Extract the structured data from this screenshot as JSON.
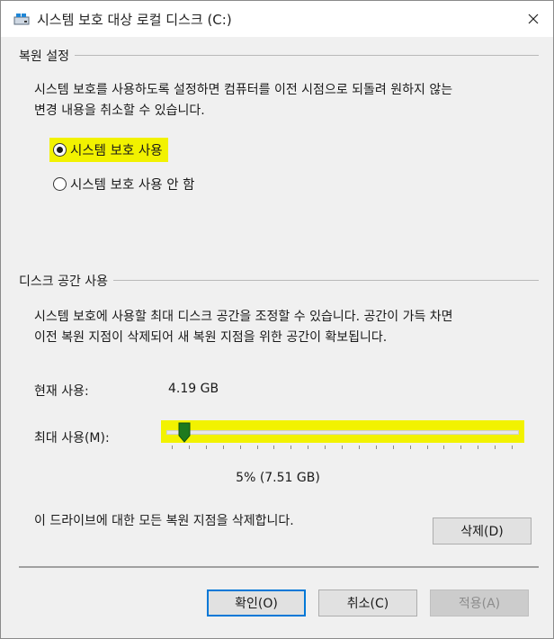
{
  "window": {
    "title": "시스템 보호 대상 로컬 디스크 (C:)",
    "close_glyph": "✕"
  },
  "restore_settings": {
    "heading": "복원 설정",
    "description_line1": "시스템 보호를 사용하도록 설정하면 컴퓨터를 이전 시점으로 되돌려 원하지 않는",
    "description_line2": "변경 내용을 취소할 수 있습니다.",
    "options": [
      {
        "label": "시스템 보호 사용",
        "selected": true
      },
      {
        "label": "시스템 보호 사용 안 함",
        "selected": false
      }
    ]
  },
  "disk_usage": {
    "heading": "디스크 공간 사용",
    "description_line1": "시스템 보호에 사용할 최대 디스크 공간을 조정할 수 있습니다. 공간이 가득 차면",
    "description_line2": "이전 복원 지점이 삭제되어 새 복원 지점을 위한 공간이 확보됩니다.",
    "current_label": "현재 사용:",
    "current_value": "4.19 GB",
    "max_label": "최대 사용(M):",
    "slider_percent": 5,
    "max_display": "5% (7.51 GB)",
    "delete_text": "이 드라이브에 대한 모든 복원 지점을 삭제합니다.",
    "delete_button": "삭제(D)"
  },
  "footer": {
    "ok": "확인(O)",
    "cancel": "취소(C)",
    "apply": "적용(A)"
  },
  "colors": {
    "highlight": "#f2f200",
    "thumb": "#1e7a1e",
    "focus_border": "#0078d7"
  }
}
